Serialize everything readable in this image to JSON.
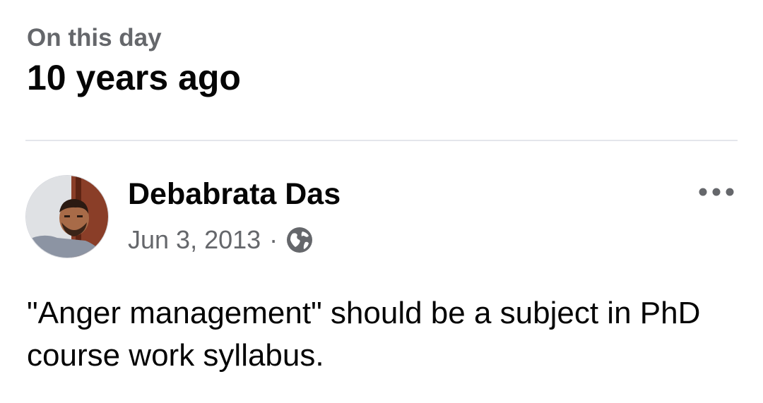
{
  "memory": {
    "kicker": "On this day",
    "headline": "10 years ago"
  },
  "post": {
    "author": "Debabrata Das",
    "date": "Jun 3, 2013",
    "separator": "·",
    "audience_icon": "globe-icon",
    "more_icon": "more-horizontal-icon",
    "text": "\"Anger management\" should be a subject in PhD course work syllabus."
  },
  "colors": {
    "primary_text": "#050505",
    "secondary_text": "#65676b",
    "divider": "#e4e6eb"
  }
}
